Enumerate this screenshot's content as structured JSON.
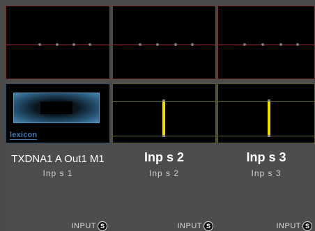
{
  "strips": [
    {
      "name": "TXDNA1 A Out1 M1",
      "sub": "Inp s 1",
      "input_label": "INPUT",
      "badge": "S",
      "logo": "lexicon"
    },
    {
      "name": "Inp s  2",
      "sub": "Inp s 2",
      "input_label": "INPUT",
      "badge": "S"
    },
    {
      "name": "Inp s  3",
      "sub": "Inp s 3",
      "input_label": "INPUT",
      "badge": "S"
    }
  ],
  "colors": {
    "envelope_line": "#a0283a",
    "fader_bar": "#f0e000",
    "lexicon_logo": "#3a78b8"
  }
}
